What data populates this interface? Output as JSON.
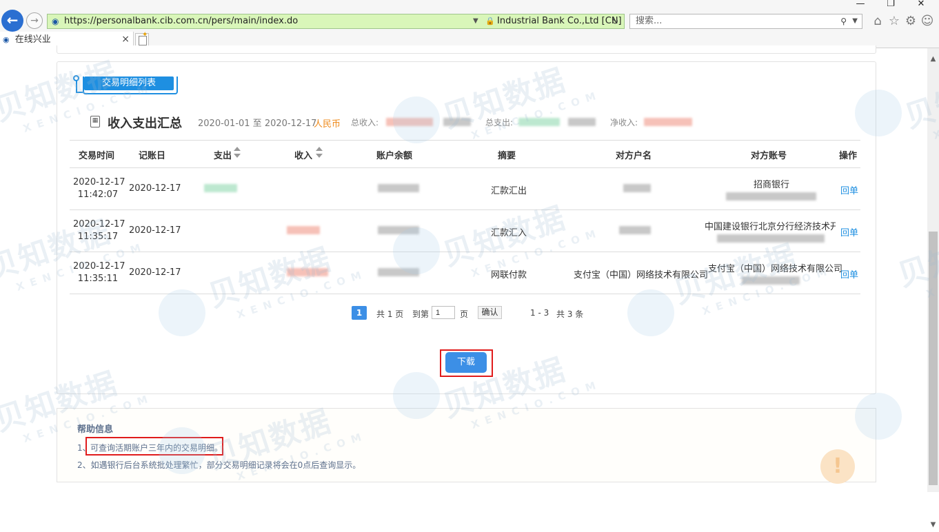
{
  "browser": {
    "url": "https://personalbank.cib.com.cn/pers/main/index.do",
    "cert": "Industrial Bank Co.,Ltd [CN]",
    "search_placeholder": "搜索...",
    "tab_title": "在线兴业"
  },
  "section_tab": "交易明细列表",
  "summary": {
    "title": "收入支出汇总",
    "range": "2020-01-01 至 2020-12-17",
    "currency": "人民币",
    "total_income_label": "总收入:",
    "total_expense_label": "总支出:",
    "net_income_label": "净收入:"
  },
  "table": {
    "columns": [
      "交易时间",
      "记账日",
      "支出",
      "收入",
      "账户余额",
      "摘要",
      "对方户名",
      "对方账号",
      "操作"
    ],
    "rows": [
      {
        "date": "2020-12-17",
        "time": "11:42:07",
        "post_date": "2020-12-17",
        "summary": "汇款汇出",
        "counterparty": "",
        "account": "招商银行",
        "action": "回单"
      },
      {
        "date": "2020-12-17",
        "time": "11:35:17",
        "post_date": "2020-12-17",
        "summary": "汇款汇入",
        "counterparty": "",
        "account": "中国建设银行北京分行经济技术开...",
        "action": "回单"
      },
      {
        "date": "2020-12-17",
        "time": "11:35:11",
        "post_date": "2020-12-17",
        "summary": "网联付款",
        "counterparty": "支付宝（中国）网络技术有限公司",
        "account": "支付宝（中国）网络技术有限公司",
        "action": "回单"
      }
    ]
  },
  "pagination": {
    "current": "1",
    "total_pages": "共 1 页",
    "goto_label": "到第",
    "page_input": "1",
    "page_unit": "页",
    "confirm": "确认",
    "range": "1 - 3",
    "total_items": "共 3 条"
  },
  "download_label": "下载",
  "help": {
    "title": "帮助信息",
    "item1_prefix": "1、",
    "item1": "可查询活期账户三年内的交易明细。",
    "item2": "2、如遇银行后台系统批处理繁忙，部分交易明细记录将会在0点后查询显示。"
  },
  "watermark": {
    "big": "贝知数据",
    "small": "XENCIO.COM"
  },
  "colors": {
    "accent": "#1e8fe1",
    "button": "#3c8fe6",
    "highlight_frame": "#e01b1b",
    "currency": "#ef8a1b",
    "help_text": "#5c6f8c"
  }
}
